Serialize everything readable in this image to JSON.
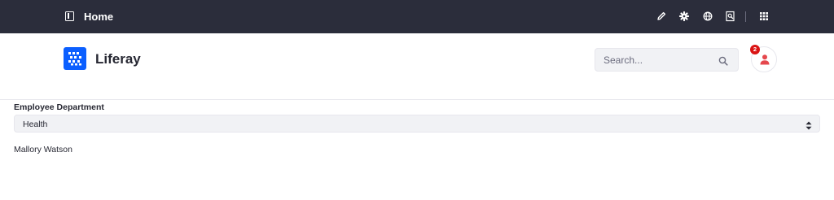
{
  "topbar": {
    "title": "Home",
    "icons": [
      "panel-toggle-icon",
      "pencil-icon",
      "gear-icon",
      "globe-icon",
      "preview-icon",
      "apps-grid-icon"
    ]
  },
  "header": {
    "brand": "Liferay",
    "search_placeholder": "Search...",
    "notification_count": "2"
  },
  "form": {
    "field_label": "Employee Department",
    "selected_value": "Health"
  },
  "results": {
    "employee_name": "Mallory Watson"
  },
  "colors": {
    "topbar_bg": "#2b2d3b",
    "brand_blue": "#0b5fff",
    "badge_red": "#da1414",
    "user_icon_red": "#e5484d"
  }
}
